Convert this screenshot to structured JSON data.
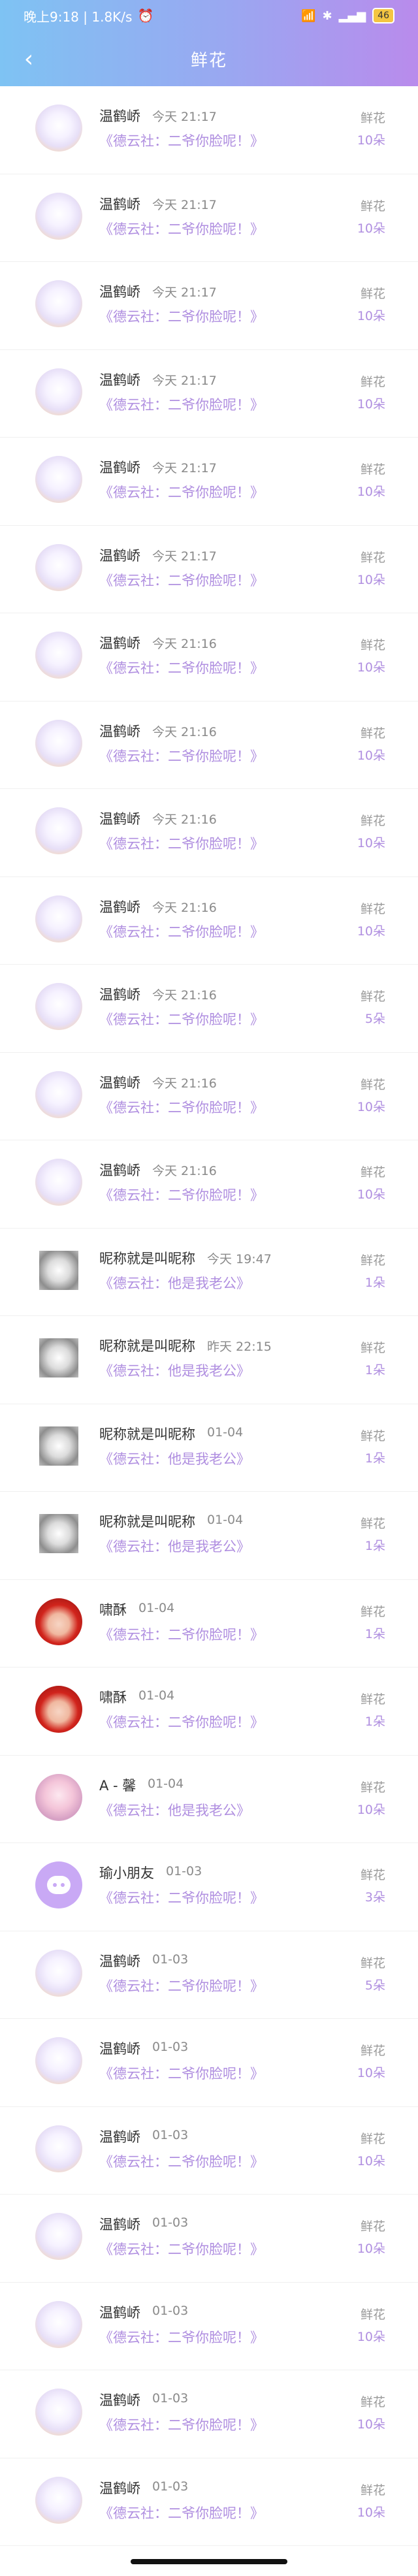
{
  "status_bar": {
    "time_speed": "晚上9:18 | 1.8K/s",
    "alarm_icon": "alarm-icon",
    "battery": "46"
  },
  "header": {
    "title": "鲜花",
    "back_icon": "back-arrow-icon"
  },
  "records": [
    {
      "name": "温鹤峤",
      "time": "今天 21:17",
      "subtitle": "《德云社：二爷你脸呢！》",
      "gift": "鲜花",
      "count": "10朵",
      "avatar": "default"
    },
    {
      "name": "温鹤峤",
      "time": "今天 21:17",
      "subtitle": "《德云社：二爷你脸呢！》",
      "gift": "鲜花",
      "count": "10朵",
      "avatar": "default"
    },
    {
      "name": "温鹤峤",
      "time": "今天 21:17",
      "subtitle": "《德云社：二爷你脸呢！》",
      "gift": "鲜花",
      "count": "10朵",
      "avatar": "default"
    },
    {
      "name": "温鹤峤",
      "time": "今天 21:17",
      "subtitle": "《德云社：二爷你脸呢！》",
      "gift": "鲜花",
      "count": "10朵",
      "avatar": "default"
    },
    {
      "name": "温鹤峤",
      "time": "今天 21:17",
      "subtitle": "《德云社：二爷你脸呢！》",
      "gift": "鲜花",
      "count": "10朵",
      "avatar": "default"
    },
    {
      "name": "温鹤峤",
      "time": "今天 21:17",
      "subtitle": "《德云社：二爷你脸呢！》",
      "gift": "鲜花",
      "count": "10朵",
      "avatar": "default"
    },
    {
      "name": "温鹤峤",
      "time": "今天 21:16",
      "subtitle": "《德云社：二爷你脸呢！》",
      "gift": "鲜花",
      "count": "10朵",
      "avatar": "default"
    },
    {
      "name": "温鹤峤",
      "time": "今天 21:16",
      "subtitle": "《德云社：二爷你脸呢！》",
      "gift": "鲜花",
      "count": "10朵",
      "avatar": "default"
    },
    {
      "name": "温鹤峤",
      "time": "今天 21:16",
      "subtitle": "《德云社：二爷你脸呢！》",
      "gift": "鲜花",
      "count": "10朵",
      "avatar": "default"
    },
    {
      "name": "温鹤峤",
      "time": "今天 21:16",
      "subtitle": "《德云社：二爷你脸呢！》",
      "gift": "鲜花",
      "count": "10朵",
      "avatar": "default"
    },
    {
      "name": "温鹤峤",
      "time": "今天 21:16",
      "subtitle": "《德云社：二爷你脸呢！》",
      "gift": "鲜花",
      "count": "5朵",
      "avatar": "default"
    },
    {
      "name": "温鹤峤",
      "time": "今天 21:16",
      "subtitle": "《德云社：二爷你脸呢！》",
      "gift": "鲜花",
      "count": "10朵",
      "avatar": "default"
    },
    {
      "name": "温鹤峤",
      "time": "今天 21:16",
      "subtitle": "《德云社：二爷你脸呢！》",
      "gift": "鲜花",
      "count": "10朵",
      "avatar": "default"
    },
    {
      "name": "昵称就是叫昵称",
      "time": "今天 19:47",
      "subtitle": "《德云社：他是我老公》",
      "gift": "鲜花",
      "count": "1朵",
      "avatar": "dog"
    },
    {
      "name": "昵称就是叫昵称",
      "time": "昨天 22:15",
      "subtitle": "《德云社：他是我老公》",
      "gift": "鲜花",
      "count": "1朵",
      "avatar": "dog"
    },
    {
      "name": "昵称就是叫昵称",
      "time": "01-04",
      "subtitle": "《德云社：他是我老公》",
      "gift": "鲜花",
      "count": "1朵",
      "avatar": "dog"
    },
    {
      "name": "昵称就是叫昵称",
      "time": "01-04",
      "subtitle": "《德云社：他是我老公》",
      "gift": "鲜花",
      "count": "1朵",
      "avatar": "dog"
    },
    {
      "name": "啸酥",
      "time": "01-04",
      "subtitle": "《德云社：二爷你脸呢！》",
      "gift": "鲜花",
      "count": "1朵",
      "avatar": "red"
    },
    {
      "name": "啸酥",
      "time": "01-04",
      "subtitle": "《德云社：二爷你脸呢！》",
      "gift": "鲜花",
      "count": "1朵",
      "avatar": "red"
    },
    {
      "name": "A - 馨",
      "time": "01-04",
      "subtitle": "《德云社：他是我老公》",
      "gift": "鲜花",
      "count": "10朵",
      "avatar": "girl"
    },
    {
      "name": "瑜小朋友",
      "time": "01-03",
      "subtitle": "《德云社：二爷你脸呢！》",
      "gift": "鲜花",
      "count": "3朵",
      "avatar": "purple"
    },
    {
      "name": "温鹤峤",
      "time": "01-03",
      "subtitle": "《德云社：二爷你脸呢！》",
      "gift": "鲜花",
      "count": "5朵",
      "avatar": "default"
    },
    {
      "name": "温鹤峤",
      "time": "01-03",
      "subtitle": "《德云社：二爷你脸呢！》",
      "gift": "鲜花",
      "count": "10朵",
      "avatar": "default"
    },
    {
      "name": "温鹤峤",
      "time": "01-03",
      "subtitle": "《德云社：二爷你脸呢！》",
      "gift": "鲜花",
      "count": "10朵",
      "avatar": "default"
    },
    {
      "name": "温鹤峤",
      "time": "01-03",
      "subtitle": "《德云社：二爷你脸呢！》",
      "gift": "鲜花",
      "count": "10朵",
      "avatar": "default"
    },
    {
      "name": "温鹤峤",
      "time": "01-03",
      "subtitle": "《德云社：二爷你脸呢！》",
      "gift": "鲜花",
      "count": "10朵",
      "avatar": "default"
    },
    {
      "name": "温鹤峤",
      "time": "01-03",
      "subtitle": "《德云社：二爷你脸呢！》",
      "gift": "鲜花",
      "count": "10朵",
      "avatar": "default"
    },
    {
      "name": "温鹤峤",
      "time": "01-03",
      "subtitle": "《德云社：二爷你脸呢！》",
      "gift": "鲜花",
      "count": "10朵",
      "avatar": "default"
    }
  ],
  "colors": {
    "accent": "#b08fe0",
    "header_gradient_start": "#7ec3f3",
    "header_gradient_end": "#b98bec"
  }
}
